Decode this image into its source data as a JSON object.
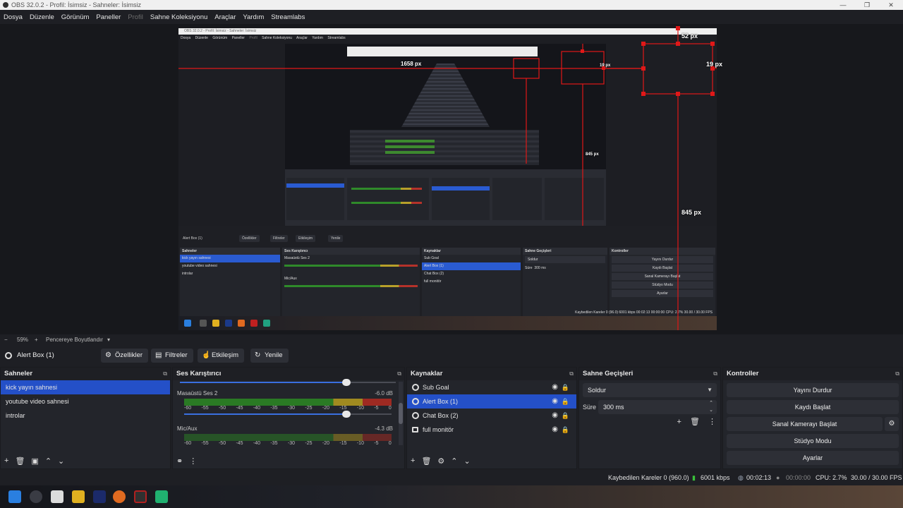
{
  "window": {
    "title": "OBS 32.0.2 - Profil: İsimsiz - Sahneler: İsimsiz",
    "controls": [
      "—",
      "❐",
      "✕"
    ]
  },
  "menu": [
    "Dosya",
    "Düzenle",
    "Görünüm",
    "Paneller",
    "Profil",
    "Sahne Koleksiyonu",
    "Araçlar",
    "Yardım",
    "Streamlabs"
  ],
  "preview_inner": {
    "title": "OBS 32.0.2 - Profil: İsimsiz - Sahneler: İsimsiz",
    "menu": [
      "Dosya",
      "Düzenle",
      "Görünüm",
      "Paneller",
      "Profil",
      "Sahne Koleksiyonu",
      "Araçlar",
      "Yardım",
      "Streamlabs"
    ],
    "zoom": "59%",
    "scale_mode": "Pencereye Boyutlandır",
    "source": "Alert Box (1)",
    "toolbar": [
      "Özellikler",
      "Filtreler",
      "Etkileşim",
      "Yenile"
    ],
    "docks": {
      "scenes": "Sahneler",
      "mixer": "Ses Karıştırıcı",
      "sources": "Kaynaklar",
      "transitions": "Sahne Geçişleri",
      "controls": "Kontroller"
    },
    "scenes": [
      "kick yayın sahnesi",
      "youtube video sahnesi",
      "introlar"
    ],
    "mixer_tracks": [
      {
        "name": "Masaüstü Ses 2",
        "db": "-6.0 dB"
      },
      {
        "name": "Mic/Aux",
        "db": "-4.3 dB"
      }
    ],
    "sources": [
      "Sub Goal",
      "Alert Box (1)",
      "Chat Box (2)",
      "full monitör"
    ],
    "transition": "Soldur",
    "duration_label": "Süre",
    "duration": "300 ms",
    "controls": [
      "Yayını Durdur",
      "Kaydı Başlat",
      "Sanal Kamerayı Başlat",
      "Stüdyo Modu",
      "Ayarlar"
    ],
    "status": "Kaybedilen Kareler 0 (96.0)   6001 kbps   00:02:13   00:00:00   CPU: 2.7%   30.00 / 30.00 FPS"
  },
  "measure_labels": {
    "top": "52 px",
    "right": "19 px",
    "left": "1658 px",
    "mid_right": "19 px",
    "bottom_mid": "845 px",
    "bottom_right": "845 px"
  },
  "zoom": {
    "minus": "−",
    "value": "59%",
    "plus": "+",
    "mode": "Pencereye Boyutlandır"
  },
  "selected_source": {
    "name": "Alert Box (1)",
    "buttons": {
      "properties": "Özellikler",
      "filters": "Filtreler",
      "interact": "Etkileşim",
      "refresh": "Yenile"
    }
  },
  "scenes": {
    "title": "Sahneler",
    "items": [
      "kick yayın sahnesi",
      "youtube video sahnesi",
      "introlar"
    ],
    "active_index": 0
  },
  "mixer": {
    "title": "Ses Karıştırıcı",
    "tracks": [
      {
        "name": "Masaüstü Ses 2",
        "db": "-6.0 dB",
        "volume": 0.82
      },
      {
        "name": "Mic/Aux",
        "db": "-4.3 dB",
        "volume": 0.85
      }
    ],
    "ticks": [
      "-60",
      "-55",
      "-50",
      "-45",
      "-40",
      "-35",
      "-30",
      "-25",
      "-20",
      "-15",
      "-10",
      "-5",
      "0"
    ]
  },
  "sources": {
    "title": "Kaynaklar",
    "items": [
      {
        "name": "Sub Goal",
        "icon": "globe-icon"
      },
      {
        "name": "Alert Box (1)",
        "icon": "globe-icon"
      },
      {
        "name": "Chat Box (2)",
        "icon": "globe-icon"
      },
      {
        "name": "full monitör",
        "icon": "monitor-icon"
      }
    ],
    "active_index": 1
  },
  "transitions": {
    "title": "Sahne Geçişleri",
    "selected": "Soldur",
    "duration_label": "Süre",
    "duration": "300 ms"
  },
  "controls": {
    "title": "Kontroller",
    "stop_stream": "Yayını Durdur",
    "start_record": "Kaydı Başlat",
    "start_virtualcam": "Sanal Kamerayı Başlat",
    "studio_mode": "Stüdyo Modu",
    "settings": "Ayarlar"
  },
  "status": {
    "dropped_frames": "Kaybedilen Kareler 0 (960.0)",
    "bitrate": "6001 kbps",
    "stream_time": "00:02:13",
    "record_time": "00:00:00",
    "cpu": "CPU: 2.7%",
    "fps": "30.00 / 30.00 FPS"
  },
  "colors": {
    "accent": "#2450c8",
    "measure": "#e01818",
    "panel": "#23252b",
    "background": "#1e1f24"
  }
}
